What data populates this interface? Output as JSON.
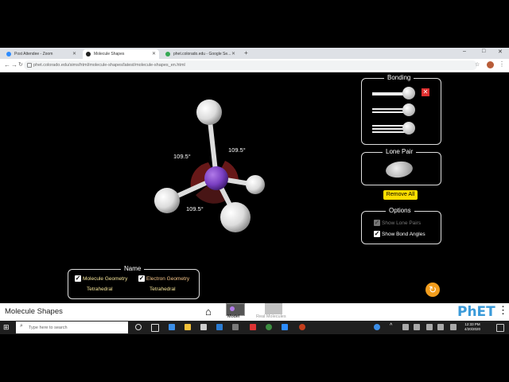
{
  "browser": {
    "tabs": [
      {
        "label": "Post Attendee - Zoom",
        "active": false,
        "favicon_color": "#2d8cff"
      },
      {
        "label": "Molecule Shapes",
        "active": true,
        "favicon_color": "#222222"
      },
      {
        "label": "phet.colorado.edu - Google Se...",
        "active": false,
        "favicon_color": "#34a853"
      }
    ],
    "new_tab": "+",
    "url": "phet.colorado.edu/sims/html/molecule-shapes/latest/molecule-shapes_en.html"
  },
  "sim": {
    "angles": [
      "109.5°",
      "109.5°",
      "109.5°"
    ],
    "bonding_panel": {
      "title": "Bonding",
      "remove_icon": "x-icon"
    },
    "lone_pair_panel": {
      "title": "Lone Pair"
    },
    "remove_all_label": "Remove All",
    "options_panel": {
      "title": "Options",
      "show_lone_pairs": {
        "label": "Show Lone Pairs",
        "checked": true,
        "enabled": false
      },
      "show_bond_angles": {
        "label": "Show Bond Angles",
        "checked": true,
        "enabled": true
      }
    },
    "name_panel": {
      "title": "Name",
      "molecule_geometry": {
        "label": "Molecule Geometry",
        "checked": true,
        "value": "Tetrahedral"
      },
      "electron_geometry": {
        "label": "Electron Geometry",
        "checked": true,
        "value": "Tetrahedral"
      }
    },
    "colors": {
      "central_atom": "#7a3fc2",
      "bond_atom": "#ffffff",
      "remove_all_bg": "#fede00",
      "electron_label": "#f7e69a"
    }
  },
  "phet_nav": {
    "sim_title": "Molecule Shapes",
    "screens": [
      {
        "label": "Model",
        "active": true
      },
      {
        "label": "Real Molecules",
        "active": false
      }
    ],
    "logo": "PhET"
  },
  "taskbar": {
    "search_placeholder": "Type here to search",
    "time": "12:33 PM",
    "date": "4/20/2020"
  }
}
